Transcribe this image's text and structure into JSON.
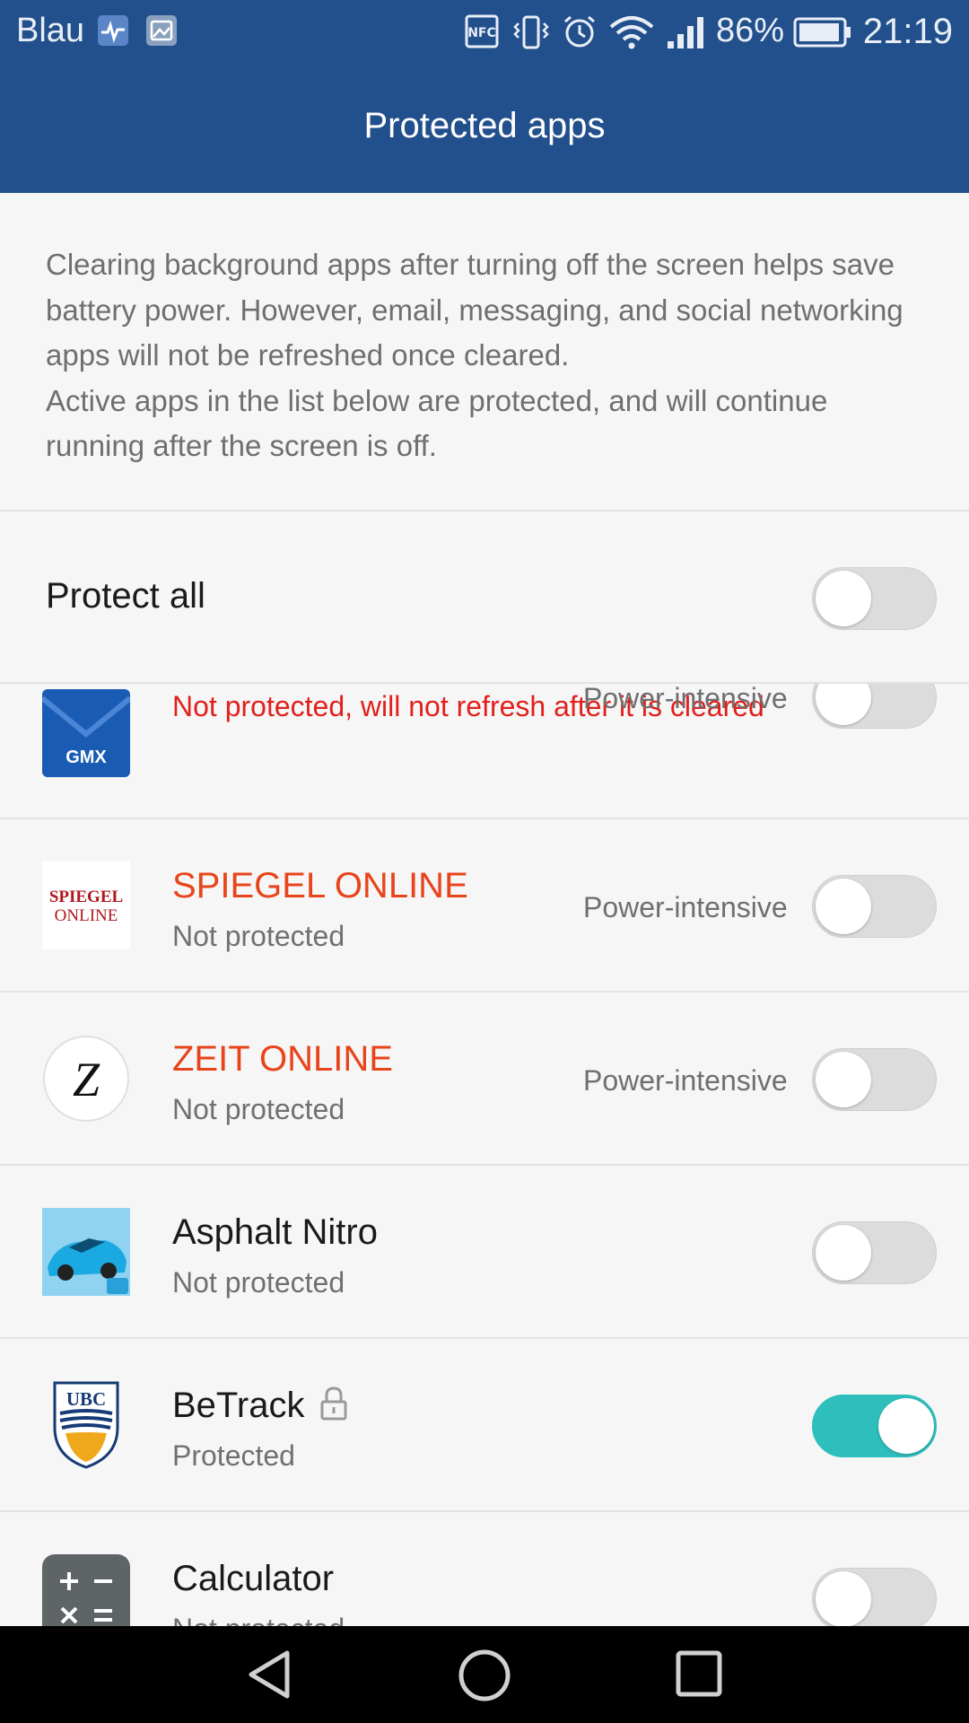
{
  "status_bar": {
    "carrier": "Blau",
    "battery_percent": "86%",
    "time": "21:19",
    "icons": [
      "health-icon",
      "image-icon",
      "nfc-icon",
      "vibrate-icon",
      "alarm-icon",
      "wifi-icon",
      "signal-icon",
      "battery-icon"
    ]
  },
  "app_bar": {
    "title": "Protected apps"
  },
  "description": {
    "line1": "Clearing background apps after turning off the screen helps save battery power. However, email, messaging, and social networking apps will not be refreshed once cleared.",
    "line2": "Active apps in the list below are protected, and will continue running after the screen is off."
  },
  "protect_all": {
    "label": "Protect all",
    "enabled": false
  },
  "apps": [
    {
      "name": "GMX",
      "status": "Not protected, will not refresh after it is cleared",
      "power": "Power-intensive",
      "protected": false,
      "icon": "gmx-icon"
    },
    {
      "name": "SPIEGEL ONLINE",
      "status": "Not protected",
      "power": "Power-intensive",
      "protected": false,
      "icon": "spiegel-online-icon",
      "icon_text": "SPIEGEL ONLINE"
    },
    {
      "name": "ZEIT ONLINE",
      "status": "Not protected",
      "power": "Power-intensive",
      "protected": false,
      "icon": "zeit-online-icon",
      "icon_text": "Z"
    },
    {
      "name": "Asphalt Nitro",
      "status": "Not protected",
      "power": "",
      "protected": false,
      "icon": "asphalt-nitro-icon"
    },
    {
      "name": "BeTrack",
      "status": "Protected",
      "power": "",
      "protected": true,
      "icon": "ubc-icon",
      "icon_text": "UBC",
      "locked": true
    },
    {
      "name": "Calculator",
      "status": "Not protected",
      "power": "",
      "protected": false,
      "icon": "calculator-icon"
    }
  ],
  "nav_bar": {
    "icons": [
      "back-icon",
      "home-icon",
      "recents-icon"
    ]
  },
  "colors": {
    "app_bar": "#22508c",
    "accent_on": "#2ebfbd",
    "warning_name": "#e8441b",
    "alert_text": "#e1201b"
  }
}
